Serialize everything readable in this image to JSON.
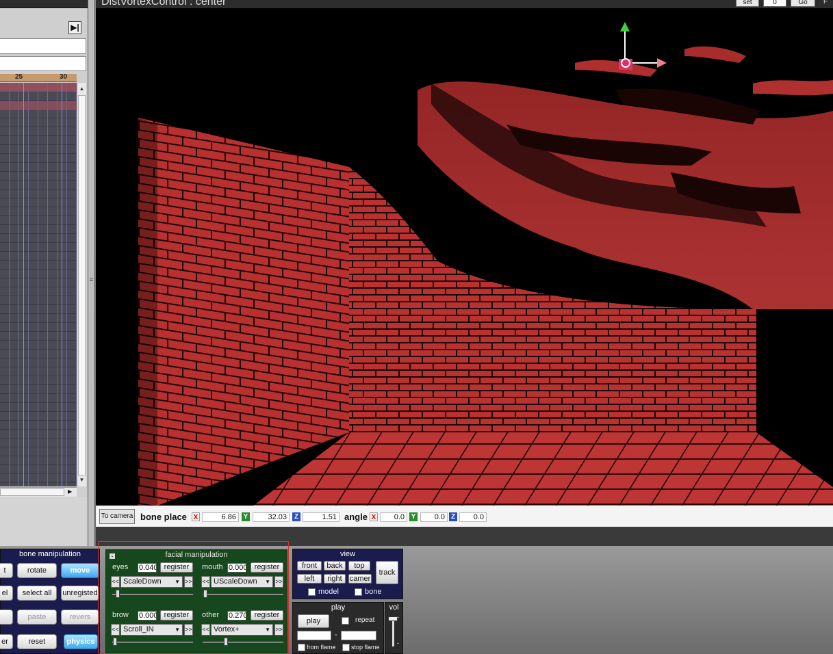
{
  "viewport": {
    "title": "DistVortexControl : center",
    "toolbar": {
      "set_label": "set",
      "frame_value": "0",
      "go_label": "Go",
      "edge_label": "F"
    }
  },
  "timeline": {
    "ruler_ticks": [
      "25",
      "30"
    ],
    "collapse_icon": "collapse-right-icon"
  },
  "coords": {
    "to_camera_label": "To camera",
    "bone_place_label": "bone place",
    "angle_label": "angle",
    "axis_x": "X",
    "axis_y": "Y",
    "axis_z": "Z",
    "place": {
      "x": "6.86",
      "y": "32.03",
      "z": "1.51"
    },
    "angle": {
      "x": "0.0",
      "y": "0.0",
      "z": "0.0"
    }
  },
  "bone_panel": {
    "title": "bone manipulation",
    "buttons": {
      "r1c1": "t",
      "rotate": "rotate",
      "move": "move",
      "r2c1": "el",
      "select_all": "select all",
      "unregistered": "unregisted",
      "r3c1": "",
      "paste": "paste",
      "reverse": "revers",
      "r4c1": "er",
      "reset": "reset",
      "physics": "physics"
    }
  },
  "facial_panel": {
    "title": "facial manipulation",
    "minus": "-",
    "eyes": {
      "label": "eyes",
      "value": "0.040",
      "register": "register",
      "select": "ScaleDown"
    },
    "mouth": {
      "label": "mouth",
      "value": "0.000",
      "register": "register",
      "select": "UScaleDown"
    },
    "brow": {
      "label": "brow",
      "value": "0.000",
      "register": "register",
      "select": "Scroll_IN"
    },
    "other": {
      "label": "other",
      "value": "0.270",
      "register": "register",
      "select": "Vortex+"
    },
    "prev": "<<",
    "next": ">>"
  },
  "view_panel": {
    "title": "view",
    "front": "front",
    "back": "back",
    "top": "top",
    "left": "left",
    "right": "right",
    "camera": "camer",
    "track": "track",
    "model_label": "model",
    "bone_label": "bone"
  },
  "play_panel": {
    "title": "play",
    "play": "play",
    "repeat_label": "repeat",
    "dash": "-",
    "from_flame_label": "from flame",
    "stop_flame_label": "stop flame"
  },
  "vol_panel": {
    "title": "vol",
    "dash": "-"
  },
  "colors": {
    "brick": "#b8302f",
    "mortar": "#1a0606",
    "panel_blue": "#1b1b4d",
    "panel_green": "#17471c"
  }
}
